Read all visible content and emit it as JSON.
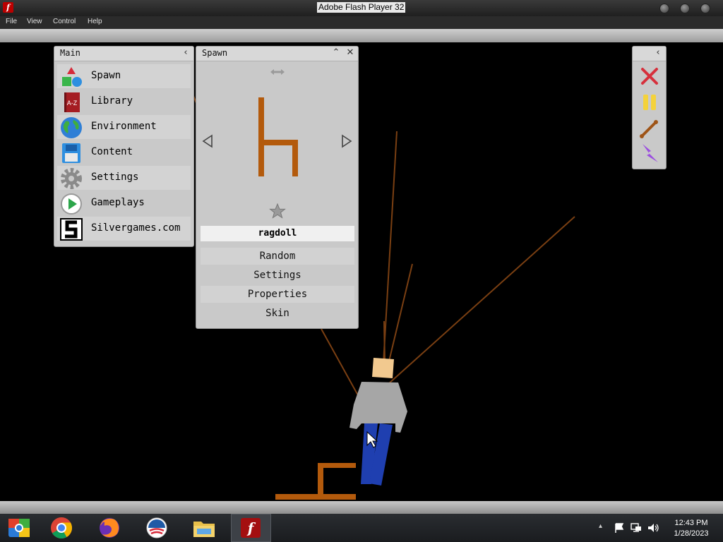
{
  "window": {
    "title": "Adobe Flash Player 32"
  },
  "menu": [
    "File",
    "View",
    "Control",
    "Help"
  ],
  "main_panel": {
    "title": "Main",
    "items": [
      {
        "label": "Spawn",
        "icon": "shapes-icon"
      },
      {
        "label": "Library",
        "icon": "book-icon"
      },
      {
        "label": "Environment",
        "icon": "globe-icon"
      },
      {
        "label": "Content",
        "icon": "floppy-icon"
      },
      {
        "label": "Settings",
        "icon": "gear-icon"
      },
      {
        "label": "Gameplays",
        "icon": "play-icon"
      },
      {
        "label": "Silvergames.com",
        "icon": "silvergames-logo"
      }
    ]
  },
  "spawn_panel": {
    "title": "Spawn",
    "selected_object": "ragdoll",
    "buttons": [
      "Random",
      "Settings",
      "Properties",
      "Skin"
    ]
  },
  "tools_panel": {
    "tools": [
      "delete-icon",
      "pause-icon",
      "stick-icon",
      "lightning-icon"
    ]
  },
  "taskbar": {
    "apps": [
      "ie-icon",
      "chrome-icon",
      "firefox-icon",
      "obama-logo-icon",
      "file-explorer-icon",
      "flash-player-icon"
    ],
    "time": "12:43 PM",
    "date": "1/28/2023"
  },
  "colors": {
    "stick": "#b35a0c",
    "rope": "#7a3f12",
    "shirt": "#a6a6a6",
    "pants": "#1f3fb0",
    "skin": "#f2c98f"
  }
}
